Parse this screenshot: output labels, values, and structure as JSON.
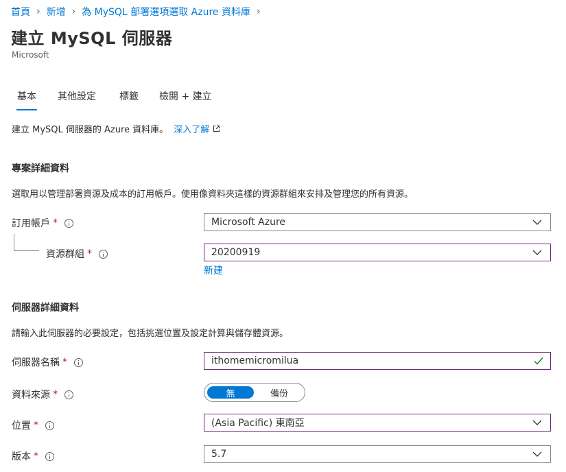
{
  "breadcrumb": {
    "items": [
      "首頁",
      "新增",
      "為 MySQL 部署選項選取 Azure 資料庫"
    ]
  },
  "header": {
    "title": "建立 MySQL 伺服器",
    "subtitle": "Microsoft"
  },
  "tabs": [
    {
      "label": "基本",
      "active": true
    },
    {
      "label": "其他設定",
      "active": false
    },
    {
      "label": "標籤",
      "active": false
    },
    {
      "label": "檢閱 + 建立",
      "active": false
    }
  ],
  "intro": {
    "text": "建立 MySQL 伺服器的 Azure 資料庫。",
    "learn_more": "深入了解"
  },
  "project_details": {
    "title": "專案詳細資料",
    "description": "選取用以管理部署資源及成本的訂用帳戶。使用像資料夾這樣的資源群組來安排及管理您的所有資源。",
    "subscription_label": "訂用帳戶",
    "subscription_value": "Microsoft Azure",
    "resource_group_label": "資源群組",
    "resource_group_value": "20200919",
    "create_new": "新建"
  },
  "server_details": {
    "title": "伺服器詳細資料",
    "description": "請輸入此伺服器的必要設定，包括挑選位置及設定計算與儲存體資源。",
    "server_name_label": "伺服器名稱",
    "server_name_value": "ithomemicromilua",
    "data_source_label": "資料來源",
    "data_source_options": [
      "無",
      "備份"
    ],
    "data_source_selected": "無",
    "location_label": "位置",
    "location_value": "(Asia Pacific) 東南亞",
    "version_label": "版本",
    "version_value": "5.7"
  },
  "required_marker": "*",
  "colors": {
    "accent": "#0078d4",
    "required": "#a4262c",
    "focus_border": "#6b2879",
    "valid_check": "#107c10"
  },
  "icons": {
    "breadcrumb_separator": "chevron-right-icon",
    "external": "external-link-icon",
    "info": "info-icon",
    "dropdown": "chevron-down-icon",
    "valid": "checkmark-icon"
  }
}
